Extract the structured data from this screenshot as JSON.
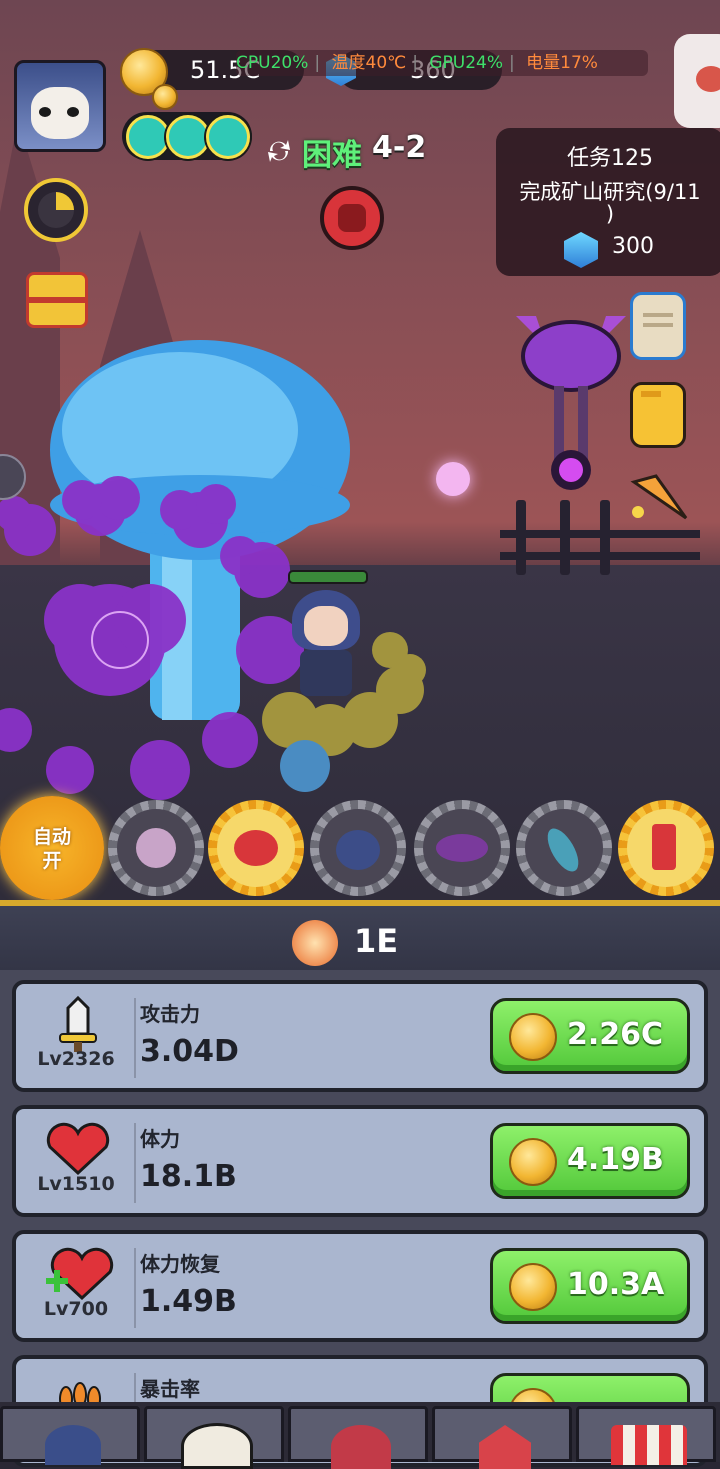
{
  "hud": {
    "gold": "51.5C",
    "gems": "360",
    "difficulty": "困难",
    "stage": "4-2"
  },
  "perf": {
    "cpu": "CPU20%",
    "temp": "温度40℃",
    "gpu": "GPU24%",
    "battery": "电量17%"
  },
  "quest": {
    "title": "任务125",
    "desc": "完成矿山研究(9/11",
    "desc_tail": ")",
    "reward": "300"
  },
  "skills": {
    "auto_label_1": "自动",
    "auto_label_2": "开"
  },
  "panel": {
    "multiplier": "1E"
  },
  "upgrades": [
    {
      "name": "攻击力",
      "value": "3.04D",
      "level": "Lv2326",
      "cost": "2.26C",
      "icon": "sword-icon"
    },
    {
      "name": "体力",
      "value": "18.1B",
      "level": "Lv1510",
      "cost": "4.19B",
      "icon": "heart-icon"
    },
    {
      "name": "体力恢复",
      "value": "1.49B",
      "level": "Lv700",
      "cost": "10.3A",
      "icon": "heart-plus-icon"
    },
    {
      "name": "暴击率",
      "value": "",
      "level": "",
      "cost": "",
      "icon": "claw-icon"
    }
  ],
  "colors": {
    "accent_gold": "#d8a92c",
    "buy_green": "#6ddc4e",
    "card_bg": "#aab6cf",
    "perf_green": "#3ee06a",
    "perf_orange": "#ff8a3c"
  }
}
